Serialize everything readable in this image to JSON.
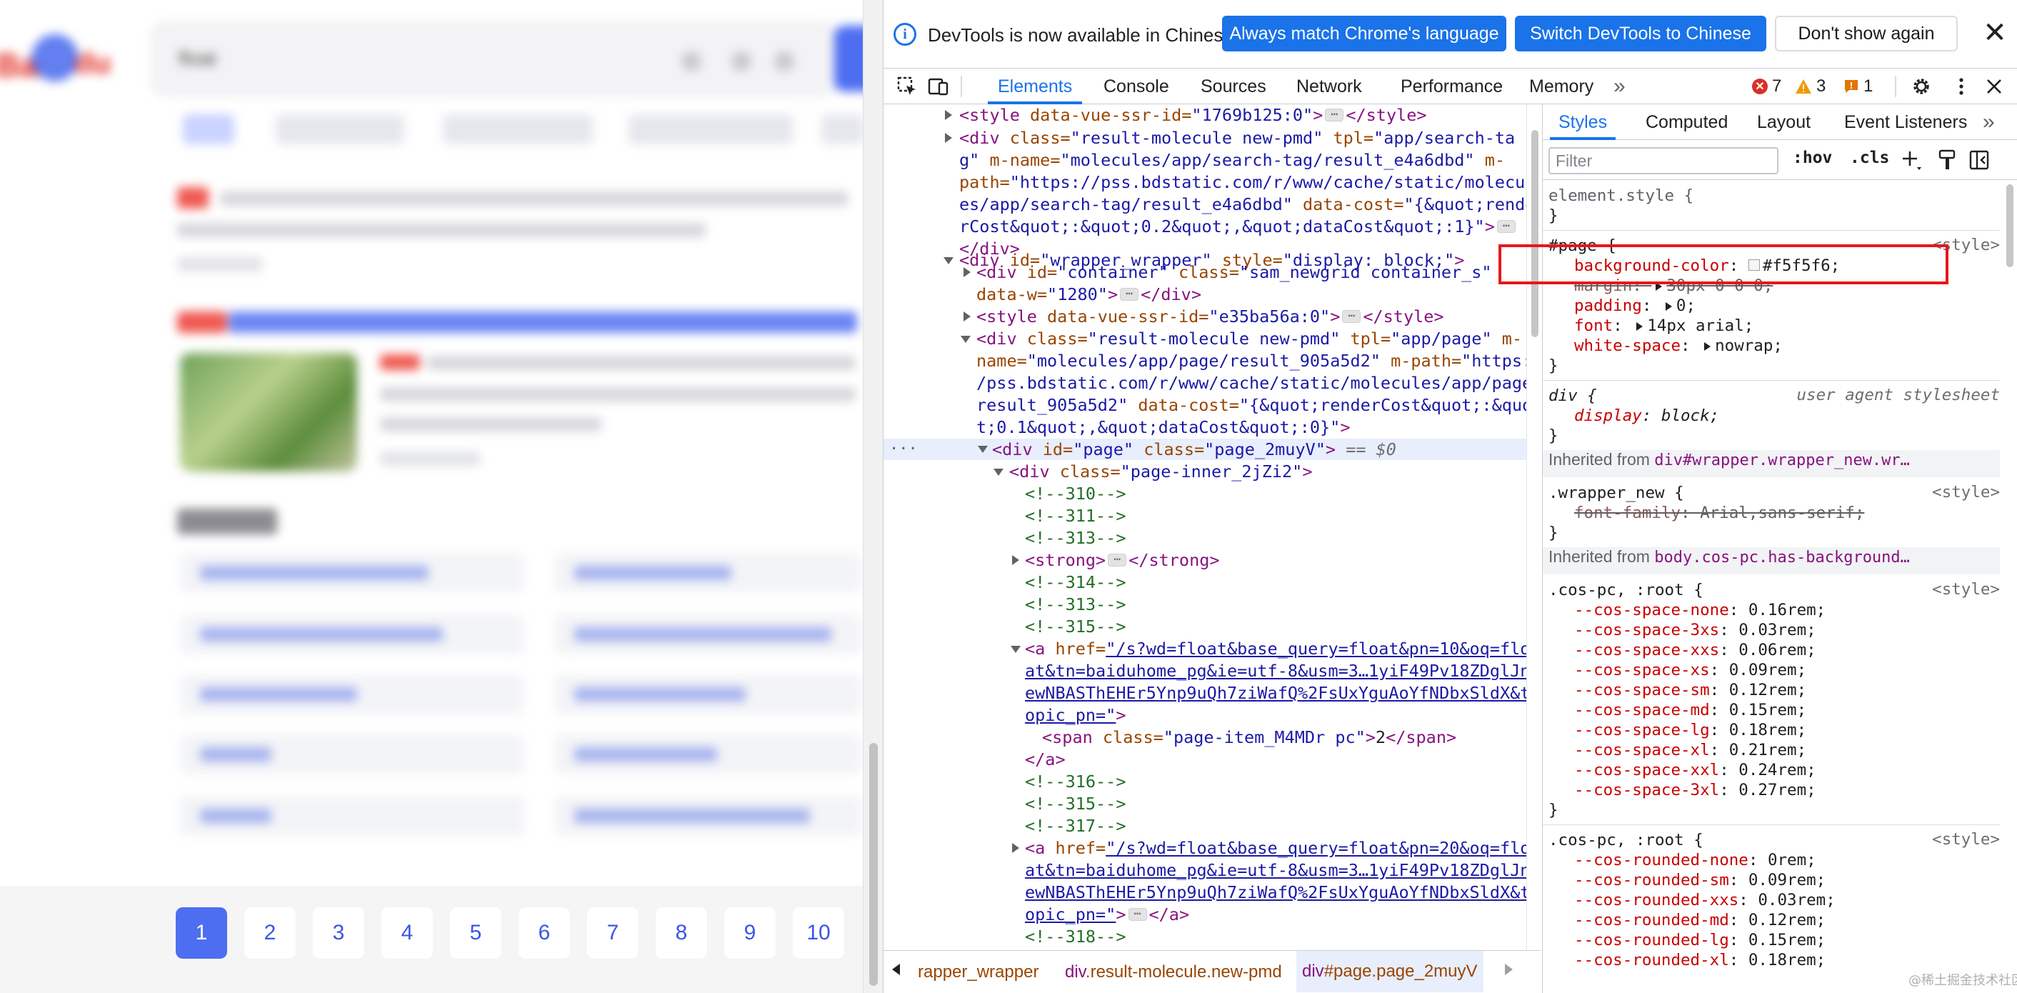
{
  "page": {
    "search_query": "float",
    "pagination": [
      "1",
      "2",
      "3",
      "4",
      "5",
      "6",
      "7",
      "8",
      "9",
      "10"
    ],
    "current_page": "1"
  },
  "devtools": {
    "infobar": {
      "message": "DevTools is now available in Chinese!",
      "btn_match": "Always match Chrome's language",
      "btn_switch": "Switch DevTools to Chinese",
      "btn_dismiss": "Don't show again",
      "close": "✕"
    },
    "tabs": [
      "Elements",
      "Console",
      "Sources",
      "Network",
      "Performance",
      "Memory"
    ],
    "more_tabs": "»",
    "counts": {
      "errors": "7",
      "warnings": "3",
      "issues": "1"
    },
    "dom": {
      "l1_tag": "<style",
      "l1_attr": " data-vue-ssr-id=",
      "l1_val": "\"1769b125:0\"",
      "l1_end": ">",
      "l1_close": "</style>",
      "l2a": "<div",
      "l2b": " class=",
      "l2c": "\"result-molecule  new-pmd\"",
      "l2d": " tpl=",
      "l2e": "\"app/search-ta",
      "l3a": "g\"",
      "l3b": " m-name=",
      "l3c": "\"molecules/app/search-tag/result_e4a6dbd\"",
      "l3d": " m-",
      "l4a": "path=",
      "l4b": "\"https://pss.bdstatic.com/r/www/cache/static/molecul",
      "l5a": "es/app/search-tag/result_e4a6dbd\"",
      "l5b": " data-cost=",
      "l5c": "\"{&quot;rende",
      "l6a": "rCost&quot;:&quot;0.2&quot;,&quot;dataCost&quot;:1}\"",
      "l6b": ">",
      "l7": "</div>",
      "l8a": "<div",
      "l8b": " id=",
      "l8c": "\"wrapper_wrapper\"",
      "l8d": " style=",
      "l8e": "\"display: block;\"",
      "l8f": ">",
      "l9a": "<div",
      "l9b": " id=",
      "l9c": "\"container\"",
      "l9d": " class=",
      "l9e": "\"sam_newgrid container_s\"",
      "l10a": "data-w=",
      "l10b": "\"1280\"",
      "l10c": ">",
      "l10d": "</div>",
      "l11a": "<style",
      "l11b": " data-vue-ssr-id=",
      "l11c": "\"e35ba56a:0\"",
      "l11d": ">",
      "l11e": "</style>",
      "l12a": "<div",
      "l12b": " class=",
      "l12c": "\"result-molecule  new-pmd\"",
      "l12d": " tpl=",
      "l12e": "\"app/page\"",
      "l12f": " m-",
      "l13a": "name=",
      "l13b": "\"molecules/app/page/result_905a5d2\"",
      "l13c": " m-path=",
      "l13d": "\"https:/",
      "l14a": "/pss.bdstatic.com/r/www/cache/static/molecules/app/page/",
      "l15a": "result_905a5d2\"",
      "l15b": " data-cost=",
      "l15c": "\"{&quot;renderCost&quot;:&quo",
      "l16a": "t;0.1&quot;,&quot;dataCost&quot;:0}\"",
      "l16b": ">",
      "l17a": "<div",
      "l17b": " id=",
      "l17c": "\"page\"",
      "l17d": " class=",
      "l17e": "\"page_2muyV\"",
      "l17f": ">",
      "l17g": " == $0",
      "l18a": "<div",
      "l18b": " class=",
      "l18c": "\"page-inner_2jZi2\"",
      "l18d": ">",
      "c310": "<!--310-->",
      "c311": "<!--311-->",
      "c313": "<!--313-->",
      "strong_open": "<strong>",
      "strong_close": "</strong>",
      "c314": "<!--314-->",
      "c313b": "<!--313-->",
      "c315": "<!--315-->",
      "a1_open": "<a",
      "a1_attr": " href=",
      "a1_l1": "\"/s?wd=float&base_query=float&pn=10&oq=flo",
      "a1_l2": "at&tn=baiduhome_pg&ie=utf-8&usm=3…1yiF49Pv18ZDglJn",
      "a1_l3": "ewNBASThEHEr5Ynp9uQh7ziWafQ%2FsUxYguAoYfNDbxSldX&t",
      "a1_l4": "opic_pn=\"",
      "a1_end": ">",
      "span_a": "<span",
      "span_b": " class=",
      "span_c": "\"page-item_M4MDr pc\"",
      "span_d": ">",
      "span_text": "2",
      "span_close": "</span>",
      "a_close": "</a>",
      "c316": "<!--316-->",
      "c315b": "<!--315-->",
      "c317": "<!--317-->",
      "a2_l1": "\"/s?wd=float&base_query=float&pn=20&oq=flo",
      "a2_l2": "at&tn=baiduhome_pg&ie=utf-8&usm=3…1yiF49Pv18ZDglJn",
      "a2_l3": "ewNBASThEHEr5Ynp9uQh7ziWafQ%2FsUxYguAoYfNDbxSldX&t",
      "a2_l4": "opic_pn=\"",
      "a2_end": ">",
      "a2_close": "</a>",
      "c318": "<!--318-->"
    },
    "breadcrumb": {
      "c1": "rapper_wrapper",
      "c2t": "div",
      "c2c": ".result-molecule.new-pmd",
      "c3t": "div",
      "c3c": "#page.page_2muyV"
    },
    "styles": {
      "subtabs": [
        "Styles",
        "Computed",
        "Layout",
        "Event Listeners"
      ],
      "more": "»",
      "filter_placeholder": "Filter",
      "hov": ":hov",
      "cls": ".cls",
      "element_style": "element.style {",
      "close_brace": "}",
      "page_selector": "#page {",
      "origin_style": "<style>",
      "p_bg_name": "background-color",
      "p_bg_val": "#f5f5f6;",
      "p_margin_name": "margin",
      "p_margin_val": "30px 0 0 0;",
      "p_padding_name": "padding",
      "p_padding_val": "0;",
      "p_font_name": "font",
      "p_font_val": "14px arial;",
      "p_ws_name": "white-space",
      "p_ws_val": "nowrap;",
      "div_selector": "div {",
      "ua_origin": "user agent stylesheet",
      "div_display_name": "display",
      "div_display_val": "block;",
      "inh1_label": "Inherited from ",
      "inh1_sel": "div#wrapper.wrapper_new.wr…",
      "wrapper_selector": ".wrapper_new {",
      "wrapper_font_name": "font-family",
      "wrapper_font_val": "Arial,sans-serif;",
      "inh2_label": "Inherited from ",
      "inh2_sel": "body.cos-pc.has-background…",
      "cospc_selector": ".cos-pc, :root {",
      "space": [
        {
          "n": "--cos-space-none",
          "v": "0.16rem;"
        },
        {
          "n": "--cos-space-3xs",
          "v": "0.03rem;"
        },
        {
          "n": "--cos-space-xxs",
          "v": "0.06rem;"
        },
        {
          "n": "--cos-space-xs",
          "v": "0.09rem;"
        },
        {
          "n": "--cos-space-sm",
          "v": "0.12rem;"
        },
        {
          "n": "--cos-space-md",
          "v": "0.15rem;"
        },
        {
          "n": "--cos-space-lg",
          "v": "0.18rem;"
        },
        {
          "n": "--cos-space-xl",
          "v": "0.21rem;"
        },
        {
          "n": "--cos-space-xxl",
          "v": "0.24rem;"
        },
        {
          "n": "--cos-space-3xl",
          "v": "0.27rem;"
        }
      ],
      "rounded": [
        {
          "n": "--cos-rounded-none",
          "v": "0rem;"
        },
        {
          "n": "--cos-rounded-sm",
          "v": "0.09rem;"
        },
        {
          "n": "--cos-rounded-xxs",
          "v": "0.03rem;"
        },
        {
          "n": "--cos-rounded-md",
          "v": "0.12rem;"
        },
        {
          "n": "--cos-rounded-lg",
          "v": "0.15rem;"
        },
        {
          "n": "--cos-rounded-xl",
          "v": "0.18rem;"
        }
      ]
    }
  },
  "watermark": "@稀土掘金技术社区",
  "colors": {
    "accent": "#1a73e8",
    "baidu_blue": "#4e6ef2",
    "highlight_red": "#e8161c",
    "page_bg": "#f5f5f6"
  }
}
